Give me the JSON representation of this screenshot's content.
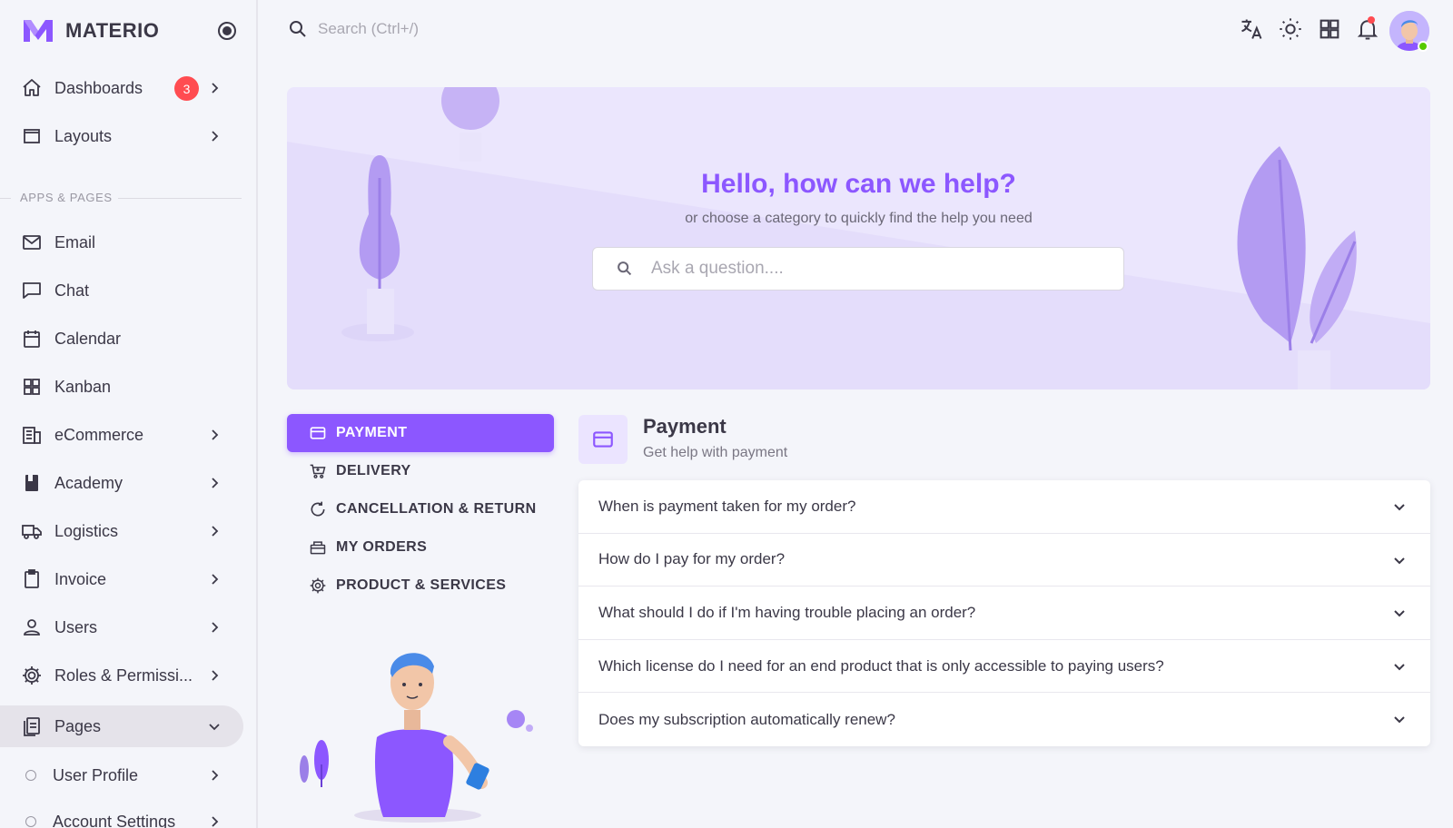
{
  "brand": {
    "name": "MATERIO"
  },
  "sidebar": {
    "section_label": "APPS & PAGES",
    "items": [
      {
        "label": "Dashboards",
        "badge": "3"
      },
      {
        "label": "Layouts"
      },
      {
        "label": "Email"
      },
      {
        "label": "Chat"
      },
      {
        "label": "Calendar"
      },
      {
        "label": "Kanban"
      },
      {
        "label": "eCommerce"
      },
      {
        "label": "Academy"
      },
      {
        "label": "Logistics"
      },
      {
        "label": "Invoice"
      },
      {
        "label": "Users"
      },
      {
        "label": "Roles & Permissi..."
      },
      {
        "label": "Pages"
      },
      {
        "label": "User Profile"
      },
      {
        "label": "Account Settings"
      }
    ]
  },
  "topbar": {
    "search_placeholder": "Search (Ctrl+/)"
  },
  "hero": {
    "title": "Hello, how can we help?",
    "subtitle": "or choose a category to quickly find the help you need",
    "search_placeholder": "Ask a question...."
  },
  "categories": [
    {
      "label": "PAYMENT",
      "icon": "credit-card-icon"
    },
    {
      "label": "DELIVERY",
      "icon": "cart-icon"
    },
    {
      "label": "CANCELLATION & RETURN",
      "icon": "refresh-icon"
    },
    {
      "label": "MY ORDERS",
      "icon": "package-icon"
    },
    {
      "label": "PRODUCT & SERVICES",
      "icon": "gear-icon"
    }
  ],
  "section": {
    "title": "Payment",
    "subtitle": "Get help with payment"
  },
  "faqs": [
    "When is payment taken for my order?",
    "How do I pay for my order?",
    "What should I do if I'm having trouble placing an order?",
    "Which license do I need for an end product that is only accessible to paying users?",
    "Does my subscription automatically renew?"
  ],
  "colors": {
    "primary": "#8c57ff",
    "hero_bg": "#ebe6fd",
    "badge": "#ff4c51",
    "online": "#56ca00"
  }
}
